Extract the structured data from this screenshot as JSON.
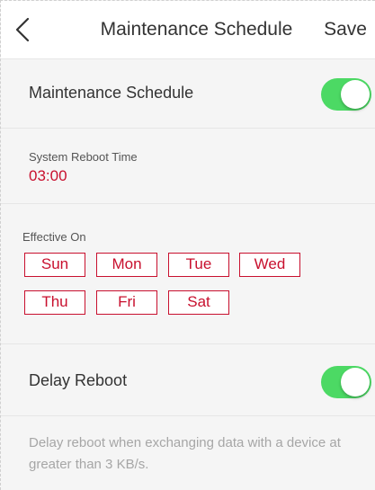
{
  "navbar": {
    "title": "Maintenance Schedule",
    "save_label": "Save"
  },
  "maintenance": {
    "label": "Maintenance Schedule",
    "enabled": true
  },
  "reboot_time": {
    "label": "System Reboot Time",
    "value": "03:00"
  },
  "effective_on": {
    "label": "Effective On",
    "days": [
      "Sun",
      "Mon",
      "Tue",
      "Wed",
      "Thu",
      "Fri",
      "Sat"
    ]
  },
  "delay_reboot": {
    "label": "Delay Reboot",
    "enabled": true,
    "description": "Delay reboot when exchanging data with a device at greater than 3 KB/s."
  },
  "colors": {
    "accent": "#c8102e",
    "toggle_on": "#4cd964"
  },
  "icons": {
    "back": "chevron-left-icon"
  }
}
